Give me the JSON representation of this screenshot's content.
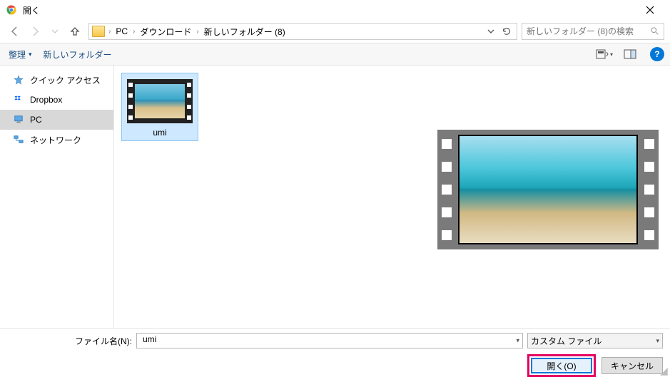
{
  "window": {
    "title": "開く"
  },
  "breadcrumb": {
    "items": [
      "PC",
      "ダウンロード",
      "新しいフォルダー (8)"
    ]
  },
  "search": {
    "placeholder": "新しいフォルダー (8)の検索"
  },
  "toolbar": {
    "organize": "整理",
    "new_folder": "新しいフォルダー"
  },
  "sidebar": {
    "items": [
      {
        "label": "クイック アクセス",
        "icon": "star"
      },
      {
        "label": "Dropbox",
        "icon": "dropbox"
      },
      {
        "label": "PC",
        "icon": "pc"
      },
      {
        "label": "ネットワーク",
        "icon": "network"
      }
    ],
    "selected_index": 2
  },
  "items": [
    {
      "label": "umi",
      "selected": true
    }
  ],
  "footer": {
    "filename_label": "ファイル名(N):",
    "filename_value": "umi",
    "filetype_label": "カスタム ファイル",
    "open_label": "開く(O)",
    "cancel_label": "キャンセル"
  }
}
